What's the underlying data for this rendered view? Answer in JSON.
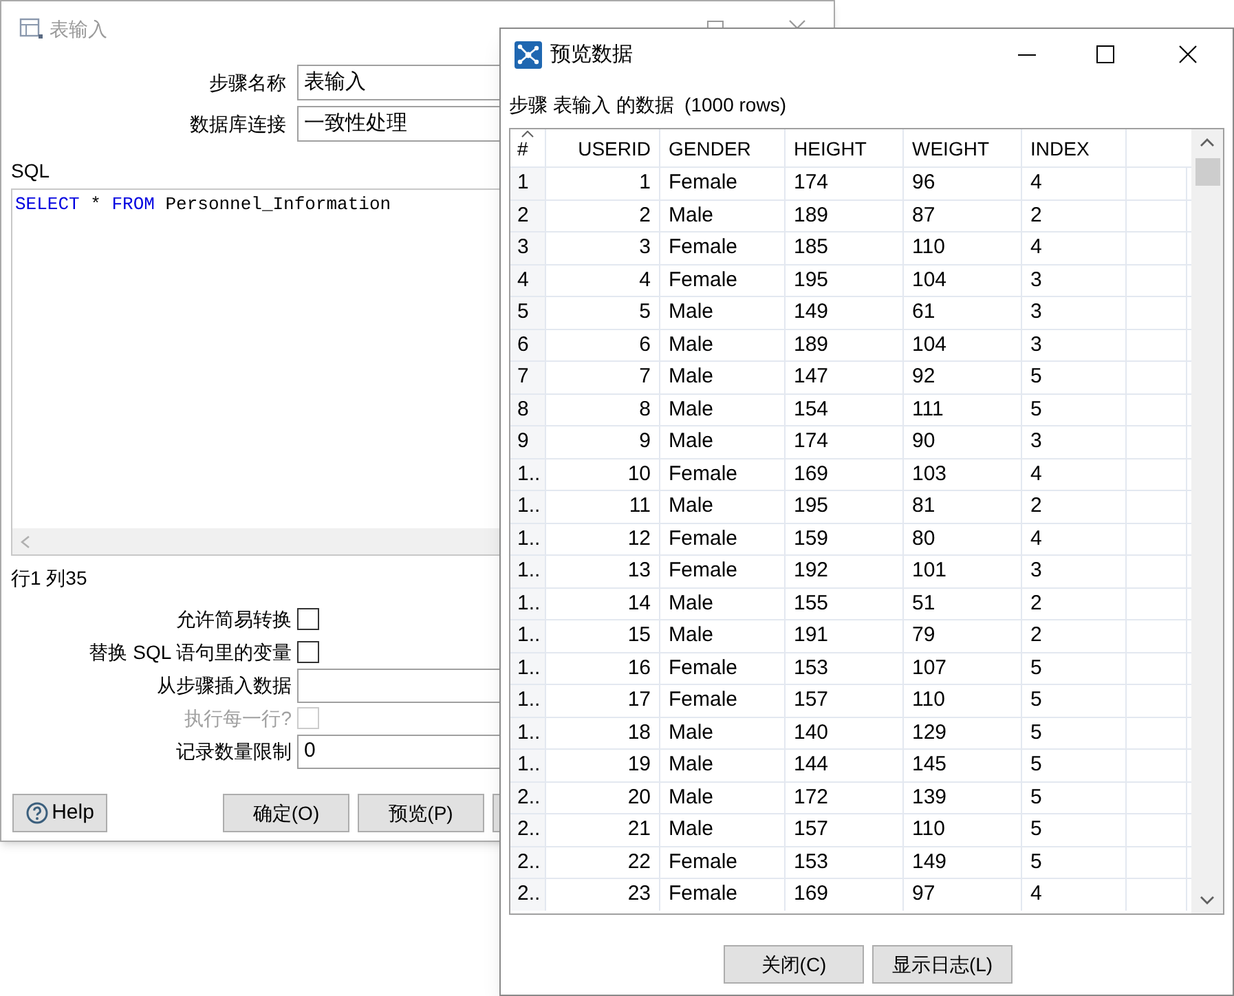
{
  "input_window": {
    "title": "表输入",
    "fields": [
      {
        "kind": "text",
        "label": "步骤名称",
        "value": "表输入"
      },
      {
        "kind": "text",
        "label": "数据库连接",
        "value": "一致性处理"
      }
    ],
    "sql_label": "SQL",
    "sql_tokens": [
      {
        "text": "SELECT",
        "kind": "keyword"
      },
      {
        "text": " * ",
        "kind": "plain"
      },
      {
        "text": "FROM",
        "kind": "keyword"
      },
      {
        "text": " Personnel_Information",
        "kind": "plain"
      }
    ],
    "cursor_position": "行1 列35",
    "options": [
      {
        "kind": "checkbox",
        "label": "允许简易转换",
        "checked": false,
        "disabled": false
      },
      {
        "kind": "checkbox",
        "label": "替换 SQL 语句里的变量",
        "checked": false,
        "disabled": false
      },
      {
        "kind": "text",
        "label": "从步骤插入数据"
      },
      {
        "kind": "checkbox",
        "label": "执行每一行?",
        "checked": false,
        "disabled": true
      },
      {
        "kind": "text",
        "label": "记录数量限制",
        "value": "0"
      }
    ],
    "help_button": "Help",
    "buttons": [
      "确定(O)",
      "预览(P)"
    ]
  },
  "preview_window": {
    "title": "预览数据",
    "caption": "步骤 表输入 的数据  (1000 rows)",
    "table": {
      "columns": [
        "#",
        "USERID",
        "GENDER",
        "HEIGHT",
        "WEIGHT",
        "INDEX"
      ],
      "rows": [
        [
          "1",
          "1",
          "Female",
          "174",
          "96",
          "4"
        ],
        [
          "2",
          "2",
          "Male",
          "189",
          "87",
          "2"
        ],
        [
          "3",
          "3",
          "Female",
          "185",
          "110",
          "4"
        ],
        [
          "4",
          "4",
          "Female",
          "195",
          "104",
          "3"
        ],
        [
          "5",
          "5",
          "Male",
          "149",
          "61",
          "3"
        ],
        [
          "6",
          "6",
          "Male",
          "189",
          "104",
          "3"
        ],
        [
          "7",
          "7",
          "Male",
          "147",
          "92",
          "5"
        ],
        [
          "8",
          "8",
          "Male",
          "154",
          "111",
          "5"
        ],
        [
          "9",
          "9",
          "Male",
          "174",
          "90",
          "3"
        ],
        [
          "1..",
          "10",
          "Female",
          "169",
          "103",
          "4"
        ],
        [
          "1..",
          "11",
          "Male",
          "195",
          "81",
          "2"
        ],
        [
          "1..",
          "12",
          "Female",
          "159",
          "80",
          "4"
        ],
        [
          "1..",
          "13",
          "Female",
          "192",
          "101",
          "3"
        ],
        [
          "1..",
          "14",
          "Male",
          "155",
          "51",
          "2"
        ],
        [
          "1..",
          "15",
          "Male",
          "191",
          "79",
          "2"
        ],
        [
          "1..",
          "16",
          "Female",
          "153",
          "107",
          "5"
        ],
        [
          "1..",
          "17",
          "Female",
          "157",
          "110",
          "5"
        ],
        [
          "1..",
          "18",
          "Male",
          "140",
          "129",
          "5"
        ],
        [
          "1..",
          "19",
          "Male",
          "144",
          "145",
          "5"
        ],
        [
          "2..",
          "20",
          "Male",
          "172",
          "139",
          "5"
        ],
        [
          "2..",
          "21",
          "Male",
          "157",
          "110",
          "5"
        ],
        [
          "2..",
          "22",
          "Female",
          "153",
          "149",
          "5"
        ],
        [
          "2..",
          "23",
          "Female",
          "169",
          "97",
          "4"
        ]
      ]
    },
    "buttons": [
      "关闭(C)",
      "显示日志(L)"
    ]
  }
}
